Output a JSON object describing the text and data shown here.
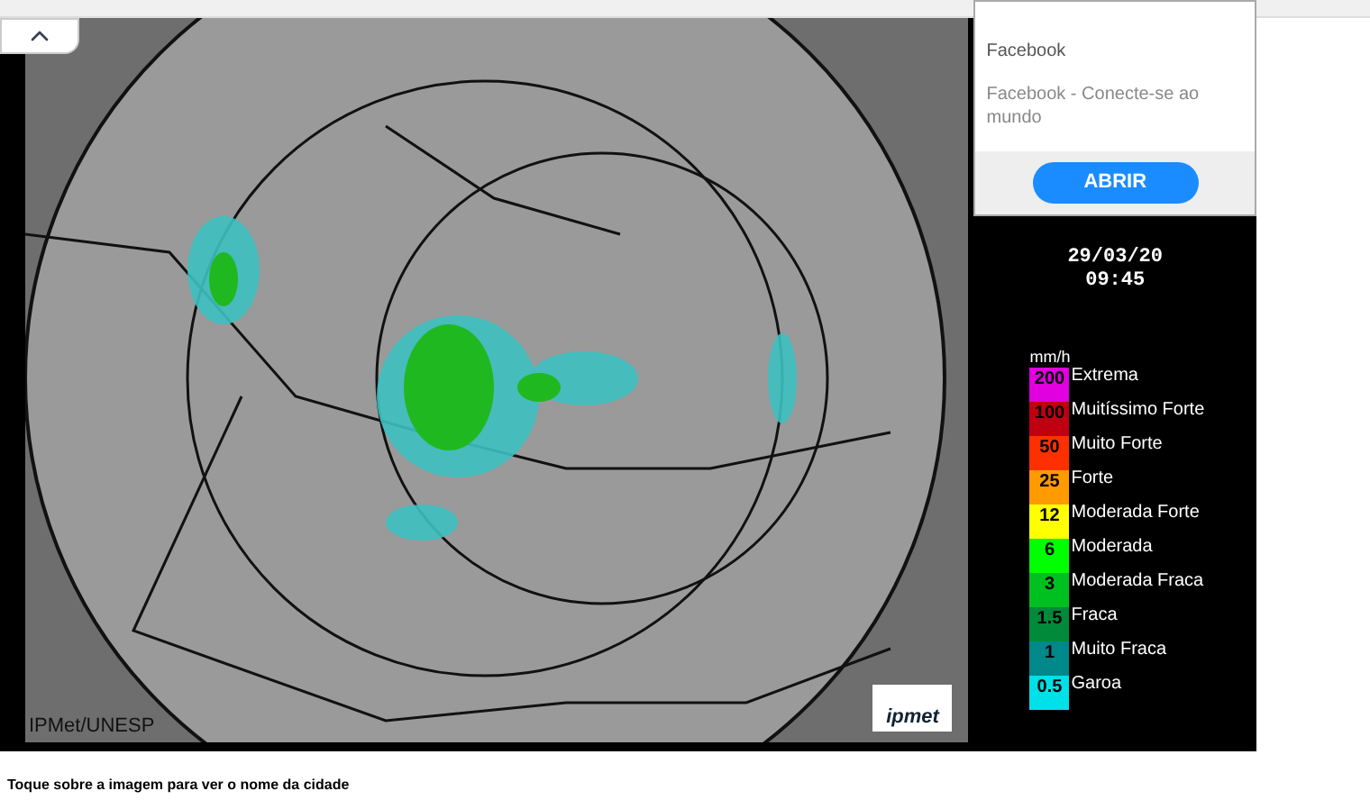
{
  "ad": {
    "source": "Facebook",
    "description": "Facebook - Conecte-se ao mundo",
    "button": "ABRIR"
  },
  "radar": {
    "date": "29/03/20",
    "time": "09:45",
    "credit": "IPMet/UNESP",
    "logo": "ipmet"
  },
  "legend": {
    "unit": "mm/h",
    "levels": [
      {
        "value": "200",
        "label": "Extrema",
        "color": "#e000e0"
      },
      {
        "value": "100",
        "label": "Muitíssimo Forte",
        "color": "#c00010"
      },
      {
        "value": "50",
        "label": "Muito Forte",
        "color": "#ff3000"
      },
      {
        "value": "25",
        "label": "Forte",
        "color": "#ff9a00"
      },
      {
        "value": "12",
        "label": "Moderada Forte",
        "color": "#ffff00"
      },
      {
        "value": "6",
        "label": "Moderada",
        "color": "#00ff00"
      },
      {
        "value": "3",
        "label": "Moderada Fraca",
        "color": "#00c020"
      },
      {
        "value": "1.5",
        "label": "Fraca",
        "color": "#008a3a"
      },
      {
        "value": "1",
        "label": "Muito Fraca",
        "color": "#00888a"
      },
      {
        "value": "0.5",
        "label": "Garoa",
        "color": "#00e0e8"
      }
    ]
  },
  "caption": "Toque sobre a imagem para ver o nome da cidade"
}
